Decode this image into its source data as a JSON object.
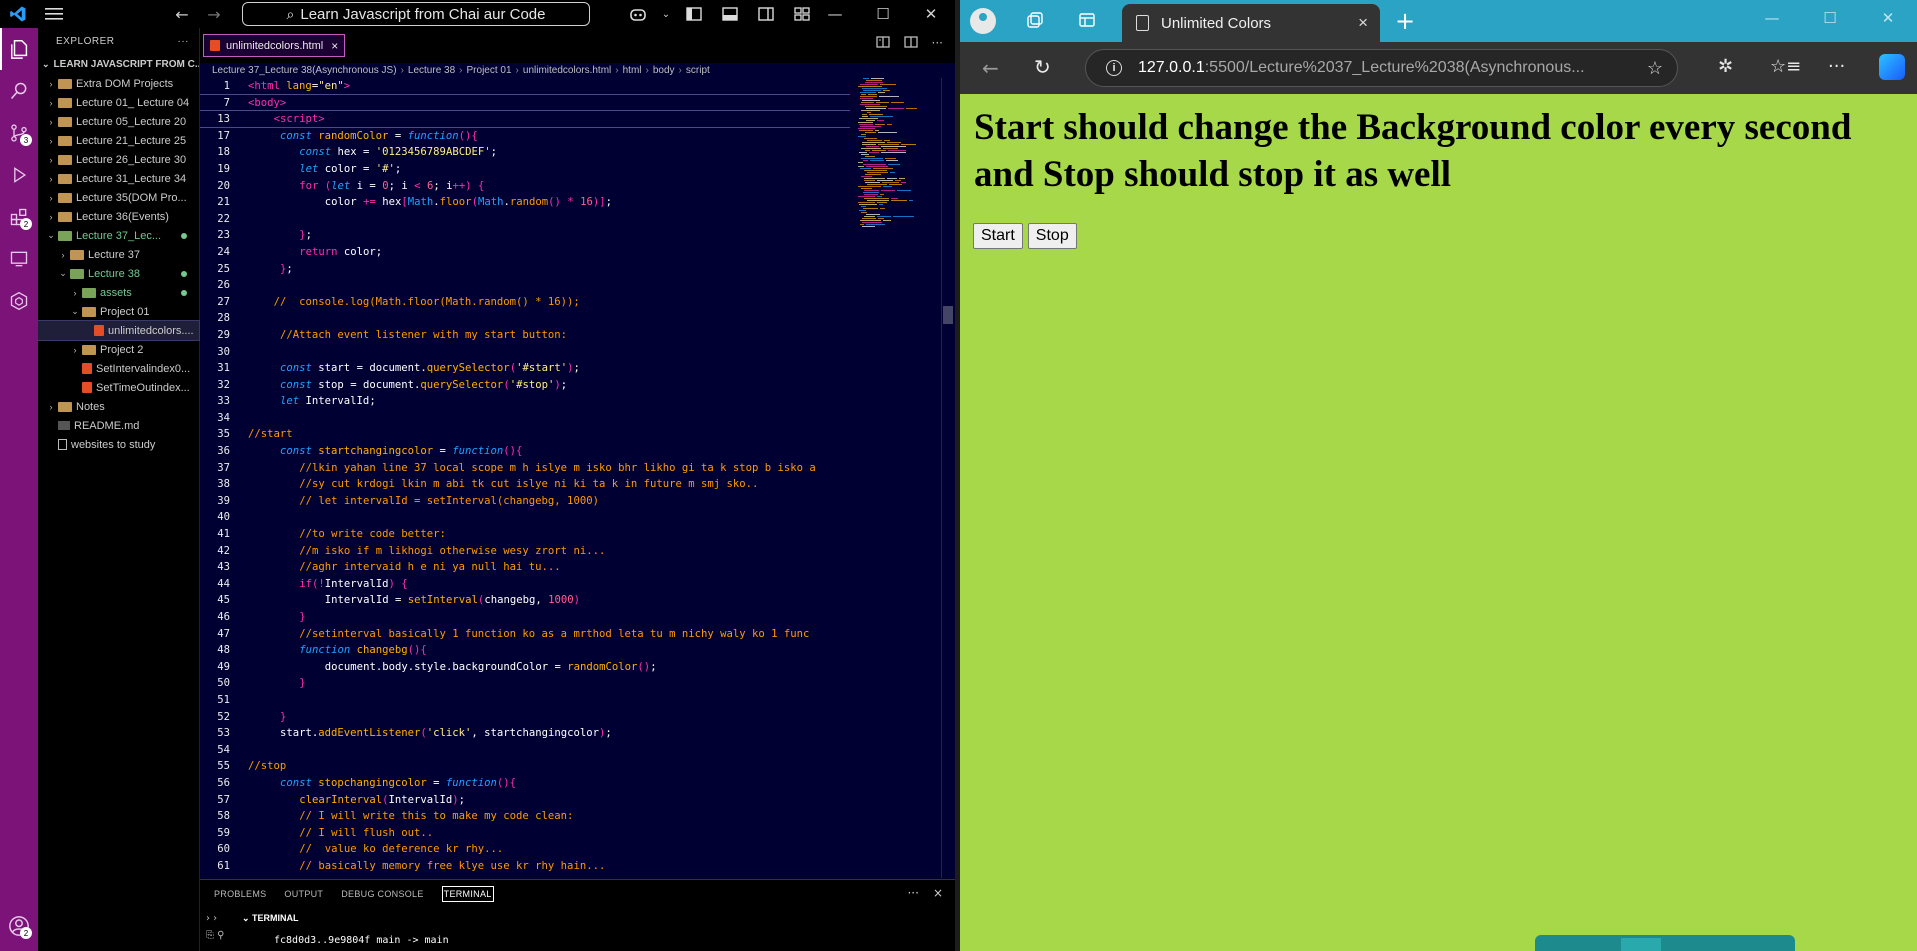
{
  "vscode": {
    "command_center": "Learn Javascript from Chai aur Code",
    "explorer_title": "EXPLORER",
    "explorer_more": "···",
    "activity_badges": [
      "3",
      "2",
      "2"
    ],
    "root_folder": "LEARN JAVASCRIPT FROM C...",
    "tree": [
      {
        "label": "Extra DOM Projects",
        "kind": "folder",
        "depth": 0,
        "chev": "›"
      },
      {
        "label": "Lecture 01_ Lecture 04",
        "kind": "folder",
        "depth": 0,
        "chev": "›"
      },
      {
        "label": "Lecture 05_Lecture 20",
        "kind": "folder",
        "depth": 0,
        "chev": "›"
      },
      {
        "label": "Lecture 21_Lecture 25",
        "kind": "folder",
        "depth": 0,
        "chev": "›"
      },
      {
        "label": "Lecture 26_Lecture 30",
        "kind": "folder",
        "depth": 0,
        "chev": "›"
      },
      {
        "label": "Lecture 31_Lecture 34",
        "kind": "folder",
        "depth": 0,
        "chev": "›"
      },
      {
        "label": "Lecture 35(DOM Pro...",
        "kind": "folder",
        "depth": 0,
        "chev": "›"
      },
      {
        "label": "Lecture 36(Events)",
        "kind": "folder",
        "depth": 0,
        "chev": "›"
      },
      {
        "label": "Lecture 37_Lec...",
        "kind": "folder-green",
        "depth": 0,
        "chev": "⌄",
        "green": true,
        "dot": true
      },
      {
        "label": "Lecture 37",
        "kind": "folder",
        "depth": 1,
        "chev": "›"
      },
      {
        "label": "Lecture 38",
        "kind": "folder-green",
        "depth": 1,
        "chev": "⌄",
        "green": true,
        "dot": true
      },
      {
        "label": "assets",
        "kind": "folder-green",
        "depth": 2,
        "chev": "›",
        "green": true,
        "dot": true
      },
      {
        "label": "Project 01",
        "kind": "folder",
        "depth": 2,
        "chev": "⌄"
      },
      {
        "label": "unlimitedcolors....",
        "kind": "html",
        "depth": 3,
        "chev": "",
        "selected": true
      },
      {
        "label": "Project 2",
        "kind": "folder",
        "depth": 2,
        "chev": "›"
      },
      {
        "label": "SetIntervalindex0...",
        "kind": "html",
        "depth": 2,
        "chev": ""
      },
      {
        "label": "SetTimeOutindex...",
        "kind": "html",
        "depth": 2,
        "chev": ""
      },
      {
        "label": "Notes",
        "kind": "folder",
        "depth": 0,
        "chev": "›"
      },
      {
        "label": "README.md",
        "kind": "md",
        "depth": 0,
        "chev": ""
      },
      {
        "label": "websites to study",
        "kind": "txt",
        "depth": 0,
        "chev": ""
      }
    ],
    "tab_label": "unlimitedcolors.html",
    "tab_close": "×",
    "breadcrumb": [
      "Lecture 37_Lecture 38(Asynchronous JS)",
      "Lecture 38",
      "Project 01",
      "unlimitedcolors.html",
      "html",
      "body",
      "script"
    ],
    "panel_tabs": [
      "PROBLEMS",
      "OUTPUT",
      "DEBUG CONSOLE",
      "TERMINAL"
    ],
    "panel_more": "···",
    "panel_close": "×",
    "terminal_title": "TERMINAL",
    "terminal_line": "fc8d0d3..9e9804f  main -> main"
  },
  "code_lines": [
    {
      "n": "1",
      "sticky": true,
      "html": "<span class=\"br\">&lt;</span><span class=\"tag\">html</span> <span class=\"attr\">lang</span><span class=\"vr\">=</span><span class=\"str\">\"en\"</span><span class=\"br\">&gt;</span>",
      "indent": 0
    },
    {
      "n": "7",
      "sticky": true,
      "html": "<span class=\"br\">&lt;</span><span class=\"tag\">body</span><span class=\"br\">&gt;</span>",
      "indent": 0
    },
    {
      "n": "13",
      "sticky": true,
      "html": "<span class=\"br\">&lt;</span><span class=\"tag\">script</span><span class=\"br\">&gt;</span>",
      "indent": 4
    },
    {
      "n": "17",
      "html": "<span class=\"kwi\">const</span> <span class=\"fn\">randomColor</span> <span class=\"vr\">=</span> <span class=\"kwi\">function</span><span class=\"br\">(){</span>",
      "indent": 5
    },
    {
      "n": "18",
      "html": "<span class=\"kwi\">const</span> <span class=\"vr\">hex</span> <span class=\"vr\">=</span> <span class=\"str\">'0123456789ABCDEF'</span><span class=\"vr\">;</span>",
      "indent": 8
    },
    {
      "n": "19",
      "html": "<span class=\"kwi\">let</span> <span class=\"vr\">color</span> <span class=\"vr\">=</span> <span class=\"str\">'#'</span><span class=\"vr\">;</span>",
      "indent": 8
    },
    {
      "n": "20",
      "html": "<span class=\"kw\">for</span> <span class=\"br\">(</span><span class=\"kwi\">let</span> <span class=\"vr\">i</span> <span class=\"vr\">=</span> <span class=\"num\">0</span><span class=\"vr\">;</span> <span class=\"vr\">i</span> <span class=\"kw\">&lt;</span> <span class=\"num\">6</span><span class=\"vr\">;</span> <span class=\"vr\">i</span><span class=\"kw\">++</span><span class=\"br\">)</span> <span class=\"br\">{</span>",
      "indent": 8
    },
    {
      "n": "21",
      "html": "<span class=\"vr\">color</span> <span class=\"kw\">+=</span> <span class=\"vr\">hex</span><span class=\"br\">[</span><span class=\"cls\">Math</span><span class=\"vr\">.</span><span class=\"mt\">floor</span><span class=\"br\">(</span><span class=\"cls\">Math</span><span class=\"vr\">.</span><span class=\"mt\">random</span><span class=\"br\">()</span> <span class=\"kw\">*</span> <span class=\"num\">16</span><span class=\"br\">)]</span><span class=\"vr\">;</span>",
      "indent": 12
    },
    {
      "n": "22",
      "html": "",
      "indent": 0
    },
    {
      "n": "23",
      "html": "<span class=\"br\">}</span><span class=\"vr\">;</span>",
      "indent": 8
    },
    {
      "n": "24",
      "html": "<span class=\"kw\">return</span> <span class=\"vr\">color</span><span class=\"vr\">;</span>",
      "indent": 8
    },
    {
      "n": "25",
      "html": "<span class=\"br\">}</span><span class=\"vr\">;</span>",
      "indent": 5
    },
    {
      "n": "26",
      "html": "",
      "indent": 0
    },
    {
      "n": "27",
      "html": "<span class=\"cm\">//  console.log(Math.floor(Math.random() * 16));</span>",
      "indent": 4
    },
    {
      "n": "28",
      "html": "",
      "indent": 0
    },
    {
      "n": "29",
      "html": "<span class=\"cm\">//Attach event listener with my start button:</span>",
      "indent": 5
    },
    {
      "n": "30",
      "html": "",
      "indent": 0
    },
    {
      "n": "31",
      "html": "<span class=\"kwi\">const</span> <span class=\"vr\">start</span> <span class=\"vr\">=</span> <span class=\"vr\">document</span><span class=\"vr\">.</span><span class=\"fn\">querySelector</span><span class=\"br\">(</span><span class=\"str\">'#start'</span><span class=\"br\">)</span><span class=\"vr\">;</span>",
      "indent": 5
    },
    {
      "n": "32",
      "html": "<span class=\"kwi\">const</span> <span class=\"vr\">stop</span> <span class=\"vr\">=</span> <span class=\"vr\">document</span><span class=\"vr\">.</span><span class=\"fn\">querySelector</span><span class=\"br\">(</span><span class=\"str\">'#stop'</span><span class=\"br\">)</span><span class=\"vr\">;</span>",
      "indent": 5
    },
    {
      "n": "33",
      "html": "<span class=\"kwi\">let</span> <span class=\"vr\">IntervalId</span><span class=\"vr\">;</span>",
      "indent": 5
    },
    {
      "n": "34",
      "html": "",
      "indent": 0
    },
    {
      "n": "35",
      "html": "<span class=\"cm\">//start</span>",
      "indent": 0
    },
    {
      "n": "36",
      "html": "<span class=\"kwi\">const</span> <span class=\"fn\">startchangingcolor</span> <span class=\"vr\">=</span> <span class=\"kwi\">function</span><span class=\"br\">(){</span>",
      "indent": 5
    },
    {
      "n": "37",
      "html": "<span class=\"cm\">//lkin yahan line 37 local scope m h islye m isko bhr likho gi ta k stop b isko a</span>",
      "indent": 8
    },
    {
      "n": "38",
      "html": "<span class=\"cm\">//sy cut krdogi lkin m abi tk cut islye ni ki ta k in future m smj sko..</span>",
      "indent": 8
    },
    {
      "n": "39",
      "html": "<span class=\"cm\">// let intervalId = setInterval(changebg, 1000)</span>",
      "indent": 8
    },
    {
      "n": "40",
      "html": "",
      "indent": 0
    },
    {
      "n": "41",
      "html": "<span class=\"cm\">//to write code better:</span>",
      "indent": 8
    },
    {
      "n": "42",
      "html": "<span class=\"cm\">//m isko if m likhogi otherwise wesy zrort ni...</span>",
      "indent": 8
    },
    {
      "n": "43",
      "html": "<span class=\"cm\">//aghr intervaid h e ni ya null hai tu...</span>",
      "indent": 8
    },
    {
      "n": "44",
      "html": "<span class=\"kw\">if</span><span class=\"br\">(</span><span class=\"kw\">!</span><span class=\"vr\">IntervalId</span><span class=\"br\">)</span> <span class=\"br\">{</span>",
      "indent": 8
    },
    {
      "n": "45",
      "html": "<span class=\"vr\">IntervalId</span> <span class=\"vr\">=</span> <span class=\"fn\">setInterval</span><span class=\"br\">(</span><span class=\"vr\">changebg</span><span class=\"vr\">,</span> <span class=\"num\">1000</span><span class=\"br\">)</span>",
      "indent": 12
    },
    {
      "n": "46",
      "html": "<span class=\"br\">}</span>",
      "indent": 8
    },
    {
      "n": "47",
      "html": "<span class=\"cm\">//setinterval basically 1 function ko as a mrthod leta tu m nichy waly ko 1 func</span>",
      "indent": 8
    },
    {
      "n": "48",
      "html": "<span class=\"kwi\">function</span> <span class=\"fn\">changebg</span><span class=\"br\">(){</span>",
      "indent": 8
    },
    {
      "n": "49",
      "html": "<span class=\"vr\">document</span><span class=\"vr\">.</span><span class=\"vr\">body</span><span class=\"vr\">.</span><span class=\"vr\">style</span><span class=\"vr\">.</span><span class=\"vr\">backgroundColor</span> <span class=\"vr\">=</span> <span class=\"fn\">randomColor</span><span class=\"br\">()</span><span class=\"vr\">;</span>",
      "indent": 12
    },
    {
      "n": "50",
      "html": "<span class=\"br\">}</span>",
      "indent": 8
    },
    {
      "n": "51",
      "html": "",
      "indent": 0
    },
    {
      "n": "52",
      "html": "<span class=\"br\">}</span>",
      "indent": 5
    },
    {
      "n": "53",
      "html": "<span class=\"vr\">start</span><span class=\"vr\">.</span><span class=\"fn\">addEventListener</span><span class=\"br\">(</span><span class=\"str\">'click'</span><span class=\"vr\">,</span> <span class=\"vr\">startchangingcolor</span><span class=\"br\">)</span><span class=\"vr\">;</span>",
      "indent": 5
    },
    {
      "n": "54",
      "html": "",
      "indent": 0
    },
    {
      "n": "55",
      "html": "<span class=\"cm\">//stop</span>",
      "indent": 0
    },
    {
      "n": "56",
      "html": "<span class=\"kwi\">const</span> <span class=\"fn\">stopchangingcolor</span> <span class=\"vr\">=</span> <span class=\"kwi\">function</span><span class=\"br\">(){</span>",
      "indent": 5
    },
    {
      "n": "57",
      "html": "<span class=\"fn\">clearInterval</span><span class=\"br\">(</span><span class=\"vr\">IntervalId</span><span class=\"br\">)</span><span class=\"vr\">;</span>",
      "indent": 8
    },
    {
      "n": "58",
      "html": "<span class=\"cm\">// I will write this to make my code clean:</span>",
      "indent": 8
    },
    {
      "n": "59",
      "html": "<span class=\"cm\">// I will flush out..</span>",
      "indent": 8
    },
    {
      "n": "60",
      "html": "<span class=\"cm\">//  value ko deference kr rhy...</span>",
      "indent": 8
    },
    {
      "n": "61",
      "html": "<span class=\"cm\">// basically memory free klye use kr rhy hain...</span>",
      "indent": 8
    }
  ],
  "browser": {
    "tab_title": "Unlimited Colors",
    "tab_close": "×",
    "new_tab": "+",
    "address_host": "127.0.0.1",
    "address_path": ":5500/Lecture%2037_Lecture%2038(Asynchronous...",
    "page_heading": "Start should change the Background color every second and Stop should stop it as well",
    "start_label": "Start",
    "stop_label": "Stop",
    "page_bg": "#a6d84a",
    "accent": "#2aa3c5"
  }
}
